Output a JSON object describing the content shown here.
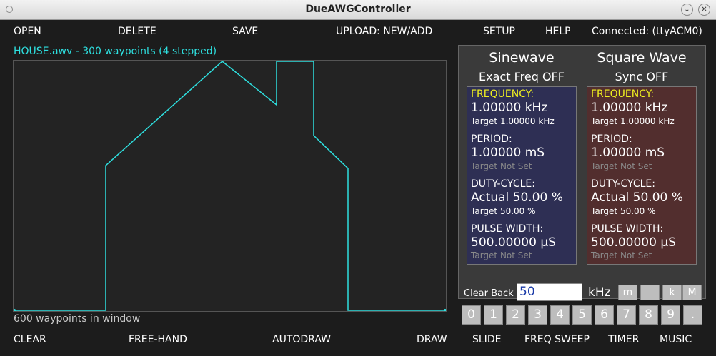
{
  "window": {
    "title": "DueAWGController"
  },
  "menu": {
    "open": "OPEN",
    "delete": "DELETE",
    "save": "SAVE",
    "upload": "UPLOAD: NEW/ADD",
    "setup": "SETUP",
    "help": "HELP",
    "status": "Connected: (ttyACM0)"
  },
  "waveform": {
    "file_label": "HOUSE.awv - 300 waypoints (4 stepped)",
    "window_label": "600 waypoints in window",
    "color": "#2ee0e0"
  },
  "sine": {
    "title": "Sinewave",
    "mode": "Exact Freq OFF",
    "frequency_label": "FREQUENCY:",
    "frequency_value": "1.00000 kHz",
    "frequency_target": "Target  1.00000 kHz",
    "period_label": "PERIOD:",
    "period_value": "1.00000 mS",
    "period_target": "Target Not Set",
    "duty_label": "DUTY-CYCLE:",
    "duty_value": "Actual 50.00 %",
    "duty_target": "Target 50.00 %",
    "pulse_label": "PULSE WIDTH:",
    "pulse_value": "500.00000 μS",
    "pulse_target": "Target Not Set"
  },
  "square": {
    "title": "Square Wave",
    "mode": "Sync OFF",
    "frequency_label": "FREQUENCY:",
    "frequency_value": "1.00000 kHz",
    "frequency_target": "Target  1.00000 kHz",
    "period_label": "PERIOD:",
    "period_value": "1.00000 mS",
    "period_target": "Target Not Set",
    "duty_label": "DUTY-CYCLE:",
    "duty_value": "Actual 50.00 %",
    "duty_target": "Target 50.00 %",
    "pulse_label": "PULSE WIDTH:",
    "pulse_value": "500.00000 μS",
    "pulse_target": "Target Not Set"
  },
  "entry": {
    "clear_back": "Clear Back",
    "value": "50",
    "unit": "kHz",
    "prefixes": [
      "m",
      "",
      "k",
      "M"
    ],
    "digits": [
      "0",
      "1",
      "2",
      "3",
      "4",
      "5",
      "6",
      "7",
      "8",
      "9",
      "."
    ]
  },
  "bottom": {
    "clear": "CLEAR",
    "freehand": "FREE-HAND",
    "autodraw": "AUTODRAW",
    "draw": "DRAW",
    "slide": "SLIDE",
    "freq_sweep": "FREQ SWEEP",
    "timer": "TIMER",
    "music": "MUSIC"
  },
  "colors": {
    "sine_panel": "#2e2f54",
    "square_panel": "#522e2e",
    "highlight_label": "#f0f020",
    "waveform_line": "#2ee0e0"
  }
}
